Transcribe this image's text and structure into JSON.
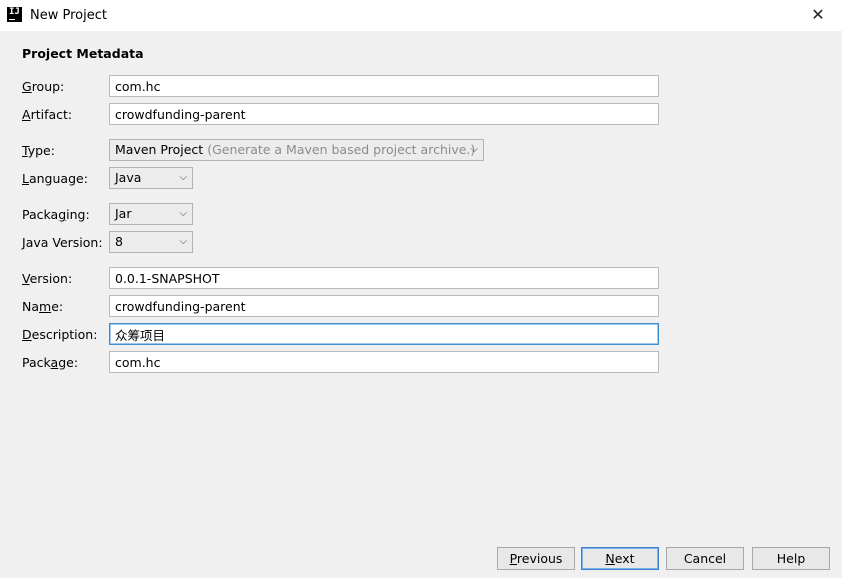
{
  "window": {
    "title": "New Project",
    "app_icon_text": "IJ",
    "close_symbol": "✕"
  },
  "form": {
    "section_title": "Project Metadata",
    "group": {
      "label_mn": "G",
      "label_rest": "roup:",
      "value": "com.hc"
    },
    "artifact": {
      "label_mn": "A",
      "label_rest": "rtifact:",
      "value": "crowdfunding-parent"
    },
    "type": {
      "label_mn": "T",
      "label_rest": "ype:",
      "value": "Maven Project",
      "hint": "(Generate a Maven based project archive.)"
    },
    "language": {
      "label_mn": "L",
      "label_rest": "anguage:",
      "value": "Java"
    },
    "packaging": {
      "label_pre": "Packa",
      "label_mn": "g",
      "label_rest": "ing:",
      "value": "Jar"
    },
    "java_version": {
      "label_mn": "J",
      "label_rest": "ava Version:",
      "value": "8"
    },
    "version": {
      "label_mn": "V",
      "label_rest": "ersion:",
      "value": "0.0.1-SNAPSHOT"
    },
    "name": {
      "label_pre": "Na",
      "label_mn": "m",
      "label_rest": "e:",
      "value": "crowdfunding-parent"
    },
    "description": {
      "label_mn": "D",
      "label_rest": "escription:",
      "value": "众筹项目"
    },
    "package": {
      "label_pre": "Pack",
      "label_mn": "a",
      "label_rest": "ge:",
      "value": "com.hc"
    }
  },
  "buttons": {
    "previous": {
      "mn": "P",
      "rest": "revious"
    },
    "next": {
      "mn": "N",
      "rest": "ext"
    },
    "cancel": "Cancel",
    "help": "Help"
  },
  "icons": {
    "chevron": "⌵"
  }
}
